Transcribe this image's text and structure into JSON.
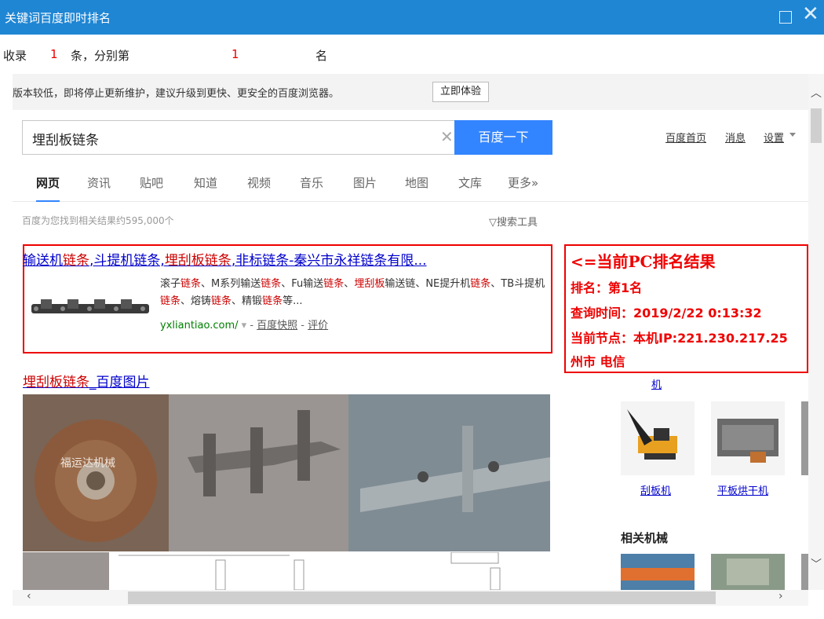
{
  "window": {
    "title": "关键词百度即时排名"
  },
  "summary": {
    "prefix": "收录",
    "count": "1",
    "mid": "条，分别第",
    "rank": "1",
    "suffix": "名"
  },
  "browser_notice": {
    "text": "版本较低，即将停止更新维护，建议升级到更快、更安全的百度浏览器。",
    "button": "立即体验"
  },
  "search": {
    "query": "埋刮板链条",
    "button": "百度一下",
    "links": [
      "百度首页",
      "消息",
      "设置"
    ]
  },
  "tabs": [
    "网页",
    "资讯",
    "贴吧",
    "知道",
    "视频",
    "音乐",
    "图片",
    "地图",
    "文库",
    "更多»"
  ],
  "result_count": "百度为您找到相关结果约595,000个",
  "search_tools": "搜索工具",
  "result1": {
    "title_parts": [
      {
        "t": "输送机",
        "em": false
      },
      {
        "t": "链条",
        "em": true
      },
      {
        "t": ",斗提机链条,",
        "em": false
      },
      {
        "t": "埋刮板链条",
        "em": true
      },
      {
        "t": ",非标链条-秦兴市永祥链条有限...",
        "em": false
      }
    ],
    "abstract_parts": [
      {
        "t": "滚子",
        "em": false
      },
      {
        "t": "链条",
        "em": true
      },
      {
        "t": "、M系列输送",
        "em": false
      },
      {
        "t": "链条",
        "em": true
      },
      {
        "t": "、Fu输送",
        "em": false
      },
      {
        "t": "链条",
        "em": true
      },
      {
        "t": "、",
        "em": false
      },
      {
        "t": "埋刮板",
        "em": true
      },
      {
        "t": "输送链、NE提升机",
        "em": false
      },
      {
        "t": "链条",
        "em": true
      },
      {
        "t": "、TB斗提机",
        "em": false
      },
      {
        "t": "链条",
        "em": true
      },
      {
        "t": "、熔铸",
        "em": false
      },
      {
        "t": "链条",
        "em": true
      },
      {
        "t": "、精锻",
        "em": false
      },
      {
        "t": "链条",
        "em": true
      },
      {
        "t": "等...",
        "em": false
      }
    ],
    "url": "yxliantiao.com/",
    "snapshot": "百度快照",
    "review": "评价"
  },
  "result2": {
    "title_parts": [
      {
        "t": "埋刮板链条",
        "em": true
      },
      {
        "t": "_百度图片",
        "em": false
      }
    ],
    "watermark": "福运达机械"
  },
  "overlay": {
    "heading": "<=当前PC排名结果",
    "rank": "排名：第1名",
    "time": "查询时间：2019/2/22 0:13:32",
    "node": "当前节点：本机IP:221.230.217.25",
    "isp": "州市 电信"
  },
  "sidebar": {
    "partial": "机",
    "items": [
      "刮板机",
      "平板烘干机"
    ],
    "heading": "相关机械"
  }
}
